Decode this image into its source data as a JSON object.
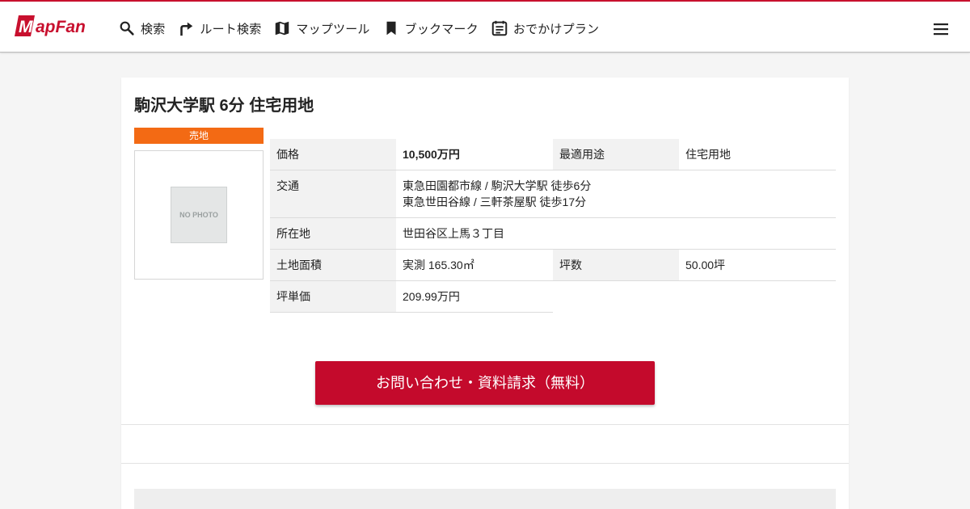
{
  "header": {
    "logo_text": "MapFan",
    "brand_color": "#c8102e",
    "nav": [
      {
        "label": "検索",
        "icon": "search-icon"
      },
      {
        "label": "ルート検索",
        "icon": "route-icon"
      },
      {
        "label": "マップツール",
        "icon": "map-icon"
      },
      {
        "label": "ブックマーク",
        "icon": "bookmark-icon"
      },
      {
        "label": "おでかけプラン",
        "icon": "calendar-icon"
      }
    ],
    "menu_icon": "hamburger-menu-icon"
  },
  "listing": {
    "title": "駒沢大学駅 6分 住宅用地",
    "badge": "売地",
    "badge_color": "#f36a14",
    "photo_placeholder": "NO PHOTO",
    "details": {
      "price_label": "価格",
      "price_value": "10,500万円",
      "use_label": "最適用途",
      "use_value": "住宅用地",
      "access_label": "交通",
      "access_lines": [
        "東急田園都市線 / 駒沢大学駅 徒歩6分",
        "東急世田谷線 / 三軒茶屋駅 徒歩17分"
      ],
      "address_label": "所在地",
      "address_value": "世田谷区上馬３丁目",
      "land_area_label": "土地面積",
      "land_area_value": "実測 165.30㎡",
      "tsubo_label": "坪数",
      "tsubo_value": "50.00坪",
      "tsubo_price_label": "坪単価",
      "tsubo_price_value": "209.99万円"
    },
    "cta_label": "お問い合わせ・資料請求（無料）",
    "cta_color": "#c40a2c"
  }
}
